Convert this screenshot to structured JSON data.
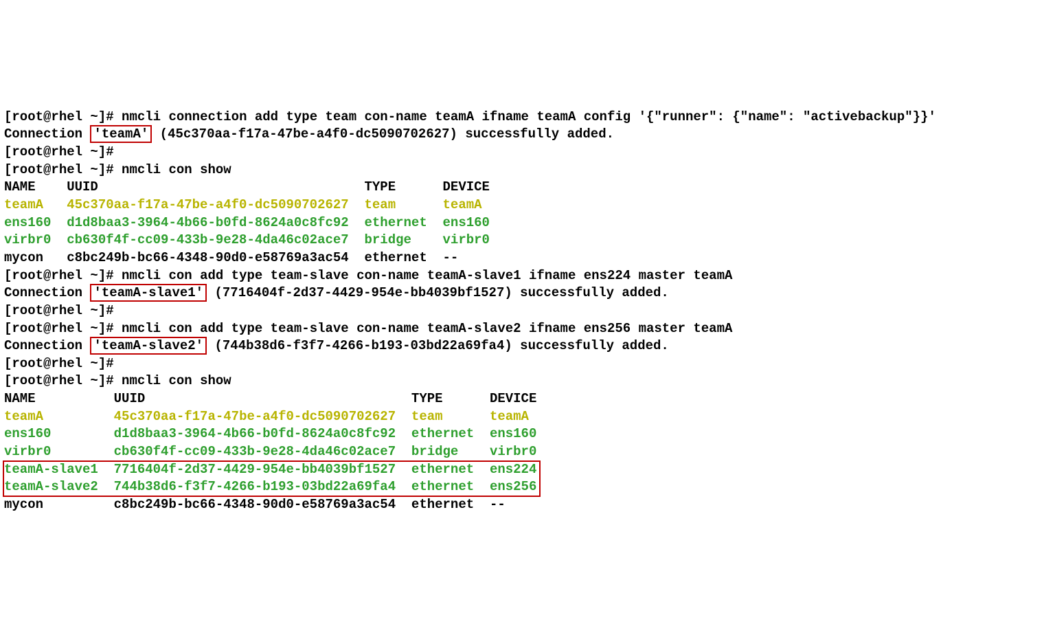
{
  "prompt": "[root@rhel ~]#",
  "cmd": {
    "add_team": "nmcli connection add type team con-name teamA ifname teamA config '{\"runner\": {\"name\": \"activebackup\"}}'",
    "show1": "nmcli con show",
    "add_slave1": "nmcli con add type team-slave con-name teamA-slave1 ifname ens224 master teamA",
    "add_slave2": "nmcli con add type team-slave con-name teamA-slave2 ifname ens256 master teamA",
    "show2": "nmcli con show"
  },
  "msg": {
    "connection": "Connection",
    "teamA_name": "'teamA'",
    "teamA_uuid": "(45c370aa-f17a-47be-a4f0-dc5090702627)",
    "slave1_name": "'teamA-slave1'",
    "slave1_uuid": "(7716404f-2d37-4429-954e-bb4039bf1527)",
    "slave2_name": "'teamA-slave2'",
    "slave2_uuid": "(744b38d6-f3f7-4266-b193-03bd22a69fa4)",
    "success": "successfully added."
  },
  "table1": {
    "hdr_name": "NAME",
    "hdr_uuid": "UUID",
    "hdr_type": "TYPE",
    "hdr_device": "DEVICE",
    "r0": {
      "name": "teamA",
      "uuid": "45c370aa-f17a-47be-a4f0-dc5090702627",
      "type": "team",
      "device": "teamA"
    },
    "r1": {
      "name": "ens160",
      "uuid": "d1d8baa3-3964-4b66-b0fd-8624a0c8fc92",
      "type": "ethernet",
      "device": "ens160"
    },
    "r2": {
      "name": "virbr0",
      "uuid": "cb630f4f-cc09-433b-9e28-4da46c02ace7",
      "type": "bridge",
      "device": "virbr0"
    },
    "r3": {
      "name": "mycon",
      "uuid": "c8bc249b-bc66-4348-90d0-e58769a3ac54",
      "type": "ethernet",
      "device": "--"
    }
  },
  "table2": {
    "hdr_name": "NAME",
    "hdr_uuid": "UUID",
    "hdr_type": "TYPE",
    "hdr_device": "DEVICE",
    "r0": {
      "name": "teamA",
      "uuid": "45c370aa-f17a-47be-a4f0-dc5090702627",
      "type": "team",
      "device": "teamA"
    },
    "r1": {
      "name": "ens160",
      "uuid": "d1d8baa3-3964-4b66-b0fd-8624a0c8fc92",
      "type": "ethernet",
      "device": "ens160"
    },
    "r2": {
      "name": "virbr0",
      "uuid": "cb630f4f-cc09-433b-9e28-4da46c02ace7",
      "type": "bridge",
      "device": "virbr0"
    },
    "r3": {
      "name": "teamA-slave1",
      "uuid": "7716404f-2d37-4429-954e-bb4039bf1527",
      "type": "ethernet",
      "device": "ens224"
    },
    "r4": {
      "name": "teamA-slave2",
      "uuid": "744b38d6-f3f7-4266-b193-03bd22a69fa4",
      "type": "ethernet",
      "device": "ens256"
    },
    "r5": {
      "name": "mycon",
      "uuid": "c8bc249b-bc66-4348-90d0-e58769a3ac54",
      "type": "ethernet",
      "device": "--"
    }
  },
  "layout": {
    "col1a": 8,
    "col2a": 38,
    "col3a": 10,
    "col1b": 14,
    "col2b": 38,
    "col3b": 10
  }
}
